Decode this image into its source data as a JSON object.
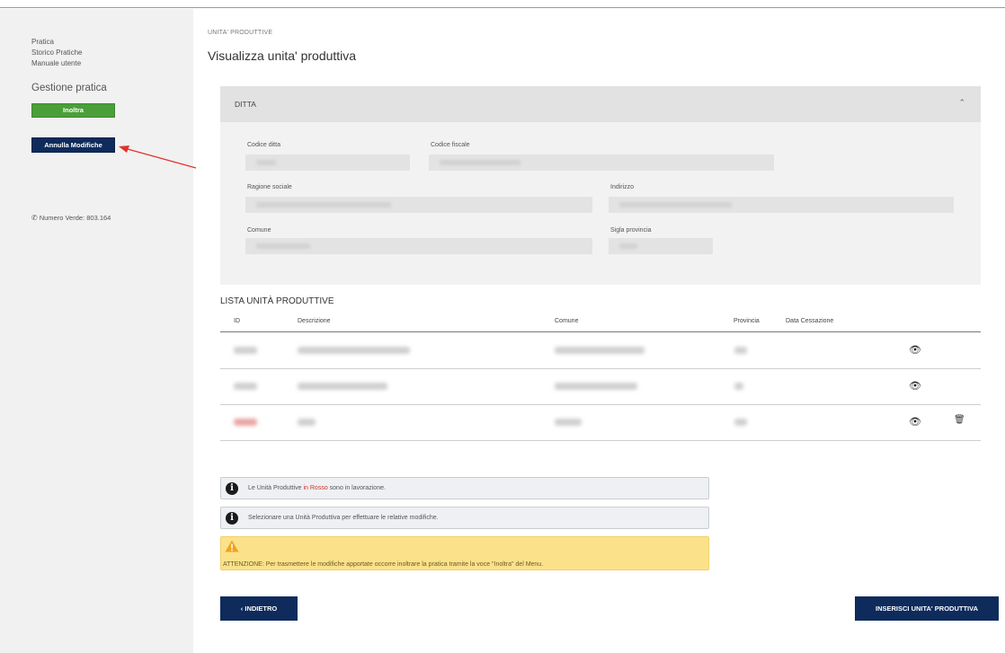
{
  "sidebar": {
    "links": [
      "Pratica",
      "Storico Pratiche",
      "Manuale utente"
    ],
    "heading": "Gestione pratica",
    "inoltra_label": "Inoltra",
    "annulla_label": "Annulla Modifiche",
    "phone_label": "Numero Verde: 803.164"
  },
  "breadcrumb": "UNITA' PRODUTTIVE",
  "page_title": "Visualizza unita' produttiva",
  "ditta": {
    "title": "DITTA",
    "fields": {
      "codice_ditta": "Codice ditta",
      "codice_fiscale": "Codice fiscale",
      "ragione_sociale": "Ragione sociale",
      "indirizzo": "Indirizzo",
      "comune": "Comune",
      "sigla_provincia": "Sigla provincia"
    }
  },
  "lista": {
    "title": "LISTA UNITÀ PRODUTTIVE",
    "columns": [
      "ID",
      "Descrizione",
      "Comune",
      "Provincia",
      "Data Cessazione"
    ]
  },
  "info": {
    "line1_before": "Le Unità Produttive ",
    "line1_red": "in Rosso",
    "line1_after": " sono in lavorazione.",
    "line2": "Selezionare una Unità Produttiva per effettuare le relative modifiche."
  },
  "warning": "ATTENZIONE: Per trasmettere le modifiche apportate occorre inoltrare la pratica tramite la voce \"Inoltra\" del Menu.",
  "buttons": {
    "indietro": "‹ INDIETRO",
    "inserisci": "INSERISCI UNITA' PRODUTTIVA"
  },
  "colors": {
    "navy": "#0e2b5c",
    "green": "#4a9f3a",
    "red_text": "#d0342c",
    "warning_bg": "#fbe28a",
    "arrow": "#e0332b"
  },
  "icons": [
    "info-icon",
    "warning-icon",
    "eye-icon",
    "trash-icon",
    "chevron-up-icon",
    "phone-icon",
    "arrow-icon"
  ]
}
